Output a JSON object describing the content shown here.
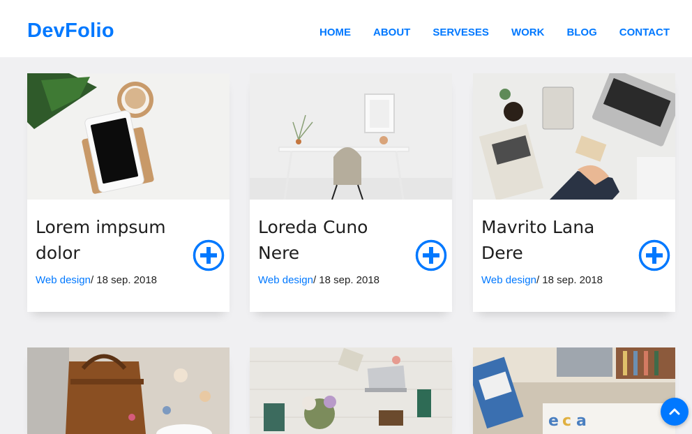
{
  "brand": "DevFolio",
  "nav": {
    "home": "HOME",
    "about": "ABOUT",
    "services": "SERVESES",
    "work": "WORK",
    "blog": "BLOG",
    "contact": "CONTACT"
  },
  "colors": {
    "accent": "#0078ff",
    "page_bg": "#f0f0f2",
    "text": "#1e1e1e"
  },
  "works": [
    {
      "title": "Lorem impsum dolor",
      "category": "Web design",
      "date": "/ 18 sep. 2018",
      "icon": "plus-circle-icon"
    },
    {
      "title": "Loreda Cuno Nere",
      "category": "Web design",
      "date": "/ 18 sep. 2018",
      "icon": "plus-circle-icon"
    },
    {
      "title": "Mavrito Lana Dere",
      "category": "Web design",
      "date": "/ 18 sep. 2018",
      "icon": "plus-circle-icon"
    }
  ],
  "scroll_top_icon": "chevron-up-icon"
}
